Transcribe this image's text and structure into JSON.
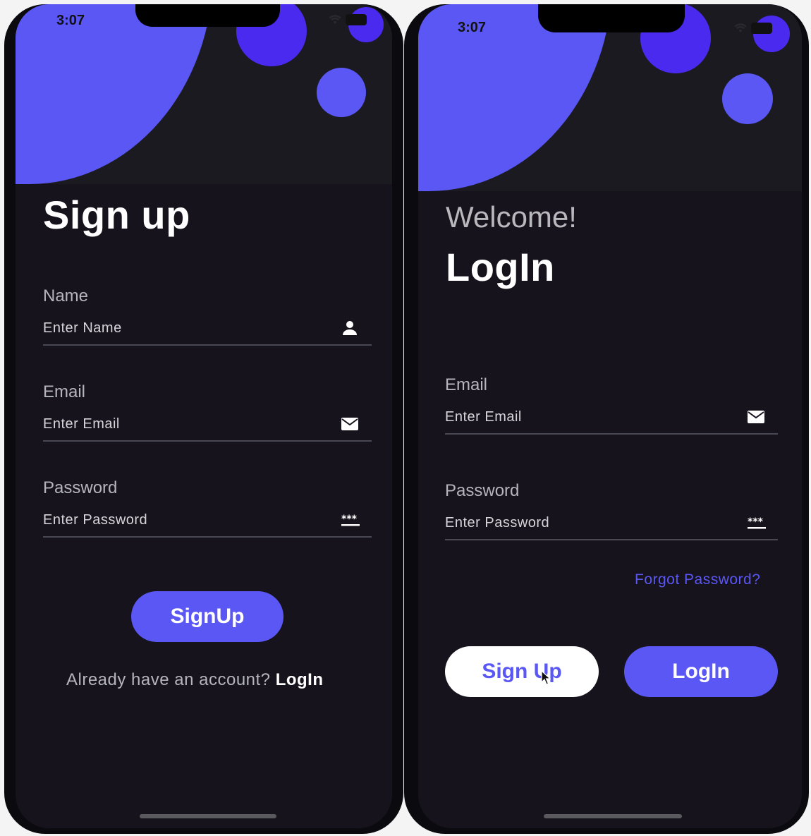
{
  "status_bar": {
    "time": "3:07"
  },
  "signup_screen": {
    "title": "Sign up",
    "fields": [
      {
        "label": "Name",
        "placeholder": "Enter Name",
        "icon": "person-icon"
      },
      {
        "label": "Email",
        "placeholder": "Enter Email",
        "icon": "mail-icon"
      },
      {
        "label": "Password",
        "placeholder": "Enter Password",
        "icon": "password-icon"
      }
    ],
    "submit_label": "SignUp",
    "footer_prompt": "Already have an account?",
    "footer_link": "LogIn"
  },
  "login_screen": {
    "greeting": "Welcome!",
    "title": "LogIn",
    "fields": [
      {
        "label": "Email",
        "placeholder": "Enter Email",
        "icon": "mail-icon"
      },
      {
        "label": "Password",
        "placeholder": "Enter Password",
        "icon": "password-icon"
      }
    ],
    "forgot_label": "Forgot Password?",
    "signup_label": "Sign Up",
    "login_label": "LogIn"
  },
  "colors": {
    "accent": "#5a57f5",
    "accent_dark": "#4b2af0",
    "background": "#16131c",
    "header_background": "#1a1a20",
    "text_primary": "#ffffff",
    "text_muted": "#b5b5bb"
  }
}
